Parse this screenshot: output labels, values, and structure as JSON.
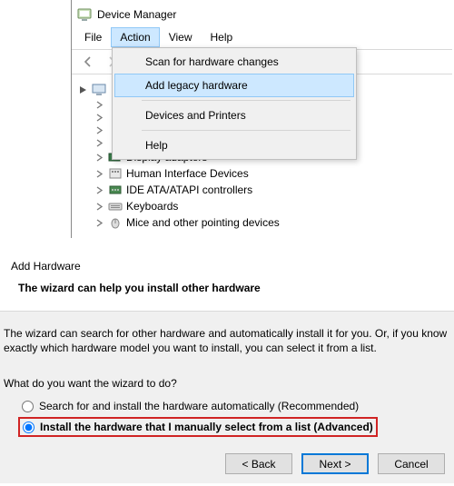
{
  "deviceManager": {
    "title": "Device Manager",
    "menu": {
      "file": "File",
      "action": "Action",
      "view": "View",
      "help": "Help"
    },
    "actionMenu": {
      "scan": "Scan for hardware changes",
      "addLegacy": "Add legacy hardware",
      "devicesPrinters": "Devices and Printers",
      "help": "Help"
    },
    "tree": {
      "root": "",
      "nodes": [
        "Display adapters",
        "Human Interface Devices",
        "IDE ATA/ATAPI controllers",
        "Keyboards",
        "Mice and other pointing devices"
      ]
    }
  },
  "wizard": {
    "title": "Add Hardware",
    "subtitle": "The wizard can help you install other hardware",
    "description": "The wizard can search for other hardware and automatically install it for you. Or, if you know exactly which hardware model you want to install, you can select it from a list.",
    "question": "What do you want the wizard to do?",
    "optionAuto": "Search for and install the hardware automatically (Recommended)",
    "optionManual": "Install the hardware that I manually select from a list (Advanced)",
    "buttons": {
      "back": "< Back",
      "next": "Next >",
      "cancel": "Cancel"
    }
  }
}
